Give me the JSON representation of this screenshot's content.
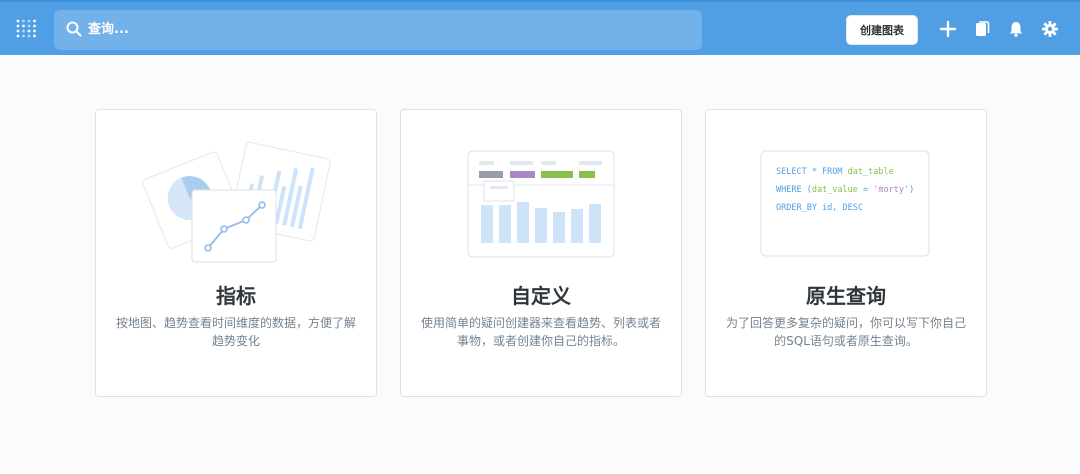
{
  "header": {
    "search_placeholder": "查询...",
    "create_button_label": "创建图表",
    "icons": [
      "metabase-logo-icon",
      "search-icon",
      "add-icon",
      "bookmark-icon",
      "notification-bell-icon",
      "settings-gear-icon"
    ]
  },
  "cards": [
    {
      "title": "指标",
      "description": "按地图、趋势查看时间维度的数据，方便了解趋势变化",
      "illustration": "metric-chart-icon"
    },
    {
      "title": "自定义",
      "description": "使用简单的疑问创建器来查看趋势、列表或者事物，或者创建你自己的指标。",
      "illustration": "custom-query-builder-icon"
    },
    {
      "title": "原生查询",
      "description": "为了回答更多复杂的疑问，你可以写下你自己的SQL语句或者原生查询。",
      "illustration": "sql-editor-icon",
      "sql": {
        "line1_kw": "SELECT * FROM",
        "line1_tbl": "dat_table",
        "line2_kw": "WHERE (",
        "line2_col": "dat_value",
        "line2_op": " = ",
        "line2_val": "'morty'",
        "line2_end": ")",
        "line3_kw": "ORDER_BY ",
        "line3_rest": "id, DESC"
      }
    }
  ],
  "colors": {
    "topbar": "#509ee3",
    "search_bg": "#72b1ea",
    "title_text": "#2e353b",
    "desc_text": "#74838f",
    "sql_keyword": "#509ee3",
    "sql_table": "#88bf4d",
    "sql_value": "#a989c5"
  }
}
